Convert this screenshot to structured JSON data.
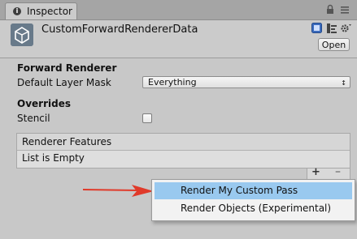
{
  "window": {
    "tab_title": "Inspector",
    "tab_icon": "info-icon",
    "tab_icons": [
      "lock-icon",
      "tab-menu-icon"
    ]
  },
  "header": {
    "title": "CustomForwardRendererData",
    "open_label": "Open",
    "icons": [
      "asset-icon",
      "help-icon",
      "preset-icon",
      "gear-icon"
    ]
  },
  "forward_renderer": {
    "section_label": "Forward Renderer",
    "layer_mask_label": "Default Layer Mask",
    "layer_mask_value": "Everything"
  },
  "overrides": {
    "section_label": "Overrides",
    "stencil_label": "Stencil",
    "stencil_checked": false
  },
  "renderer_features": {
    "header_label": "Renderer Features",
    "empty_text": "List is Empty",
    "add_label": "+",
    "remove_label": "–"
  },
  "context_menu": {
    "items": [
      {
        "label": "Render My Custom Pass",
        "highlighted": true
      },
      {
        "label": "Render Objects (Experimental)",
        "highlighted": false
      }
    ]
  },
  "colors": {
    "arrow": "#e03a2a",
    "menu_highlight": "#99c9ef"
  }
}
